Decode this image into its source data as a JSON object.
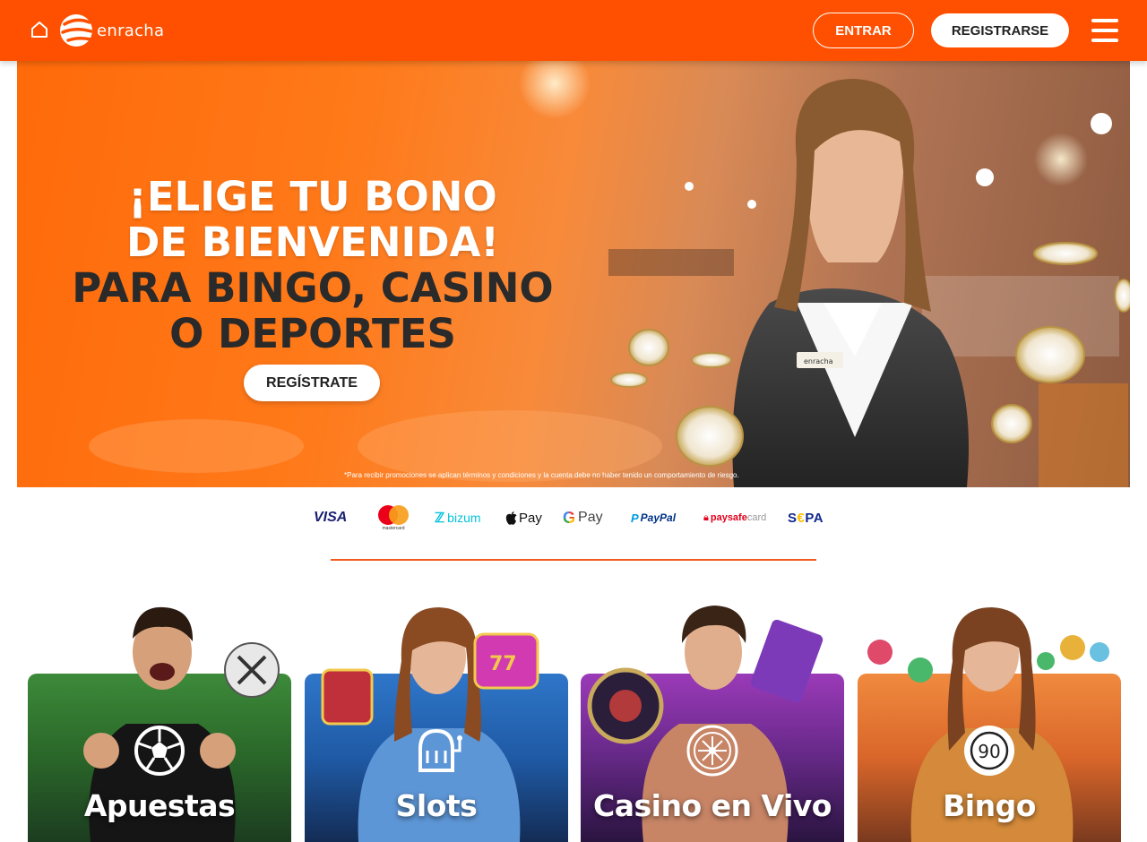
{
  "header": {
    "brand": "enracha",
    "login_label": "ENTRAR",
    "register_label": "REGISTRARSE",
    "icons": {
      "home": "home-icon",
      "menu": "hamburger-menu-icon"
    },
    "colors": {
      "brand_orange": "#fe5000",
      "white": "#ffffff"
    }
  },
  "hero": {
    "headline_line1": "¡ELIGE TU BONO",
    "headline_line2": "DE BIENVENIDA!",
    "headline_line3": "PARA BINGO, CASINO",
    "headline_line4": "O DEPORTES",
    "cta_label": "REGÍSTRATE",
    "disclaimer": "*Para recibir promociones se aplican términos y condiciones y la cuenta debe no haber tenido un comportamiento de riesgo.",
    "badge_text": "enracha"
  },
  "payments": {
    "visa": "VISA",
    "mastercard": "mastercard",
    "bizum": "bizum",
    "apple_pay": "Pay",
    "google_pay": "Pay",
    "paypal": "PayPal",
    "paysafecard_a": "paysafe",
    "paysafecard_b": "card",
    "sepa_a": "S",
    "sepa_b": "€",
    "sepa_c": "PA"
  },
  "categories": [
    {
      "title": "Apuestas",
      "icon": "soccer-ball-icon",
      "accent": "#2e7d32"
    },
    {
      "title": "Slots",
      "icon": "slot-machine-icon",
      "accent": "#1e5aa8"
    },
    {
      "title": "Casino en Vivo",
      "icon": "roulette-icon",
      "accent": "#7a2d8c"
    },
    {
      "title": "Bingo",
      "icon": "bingo-ball-icon",
      "accent": "#e0662a"
    }
  ]
}
